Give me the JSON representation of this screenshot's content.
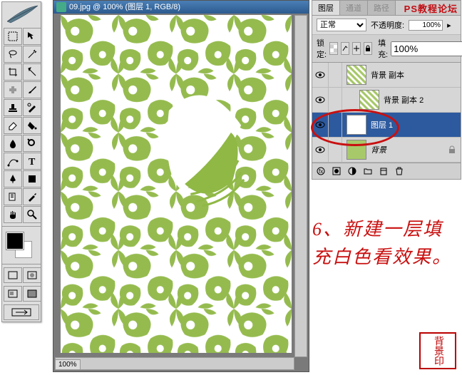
{
  "watermark": "PS教程论坛",
  "document": {
    "title": "09.jpg @ 100% (图层 1, RGB/8)",
    "zoom": "100%"
  },
  "panels": {
    "tabs": [
      "图层",
      "通道",
      "路径"
    ],
    "blend_mode": "正常",
    "opacity_label": "不透明度:",
    "opacity_value": "100%",
    "lock_label": "锁定:",
    "fill_label": "填充:",
    "fill_value": "100%"
  },
  "layers": [
    {
      "name": "背景 副本",
      "selected": false,
      "thumb": "pattern",
      "bg": false
    },
    {
      "name": "背景 副本 2",
      "selected": false,
      "thumb": "pattern",
      "bg": false,
      "indent": true
    },
    {
      "name": "图层 1",
      "selected": true,
      "thumb": "white",
      "bg": false
    },
    {
      "name": "背景",
      "selected": false,
      "thumb": "green",
      "bg": true
    }
  ],
  "annotation": "6、新建一层填充白色看效果。",
  "seal": "背景印"
}
